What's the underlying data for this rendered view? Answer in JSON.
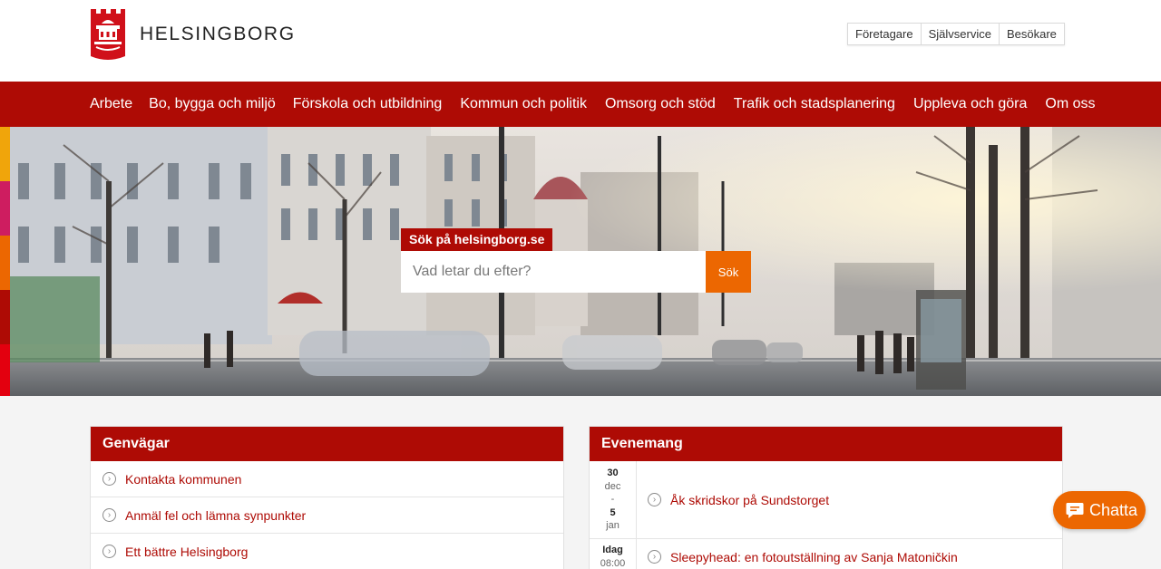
{
  "header": {
    "logo_text": "HELSINGBORG",
    "top_links": [
      "Företagare",
      "Självservice",
      "Besökare"
    ]
  },
  "nav": {
    "items": [
      "Arbete",
      "Bo, bygga och miljö",
      "Förskola och utbildning",
      "Kommun och politik",
      "Omsorg och stöd",
      "Trafik och stadsplanering",
      "Uppleva och göra",
      "Om oss"
    ]
  },
  "search": {
    "label": "Sök på helsingborg.se",
    "placeholder": "Vad letar du efter?",
    "button_label": "Sök"
  },
  "shortcuts": {
    "title": "Genvägar",
    "items": [
      "Kontakta kommunen",
      "Anmäl fel och lämna synpunkter",
      "Ett bättre Helsingborg"
    ]
  },
  "events": {
    "title": "Evenemang",
    "items": [
      {
        "date_line1": "30",
        "date_line2": "dec",
        "date_line3": "-",
        "date_line4": "5",
        "date_line5": "jan",
        "title": "Åk skridskor på Sundstorget"
      },
      {
        "date_line1": "Idag",
        "date_line2": "08:00",
        "title": "Sleepyhead: en fotoutställning av Sanja Matoničkin"
      }
    ]
  },
  "chat": {
    "label": "Chatta"
  },
  "colors": {
    "brand_red": "#ae0b05",
    "accent_orange": "#ec6701",
    "link_red": "#ae0b05"
  },
  "icons": {
    "shortcut_icon": "arrow-circle-right-icon",
    "chat_icon": "chat-bubble-icon",
    "logo_icon": "helsingborg-crest-icon"
  }
}
